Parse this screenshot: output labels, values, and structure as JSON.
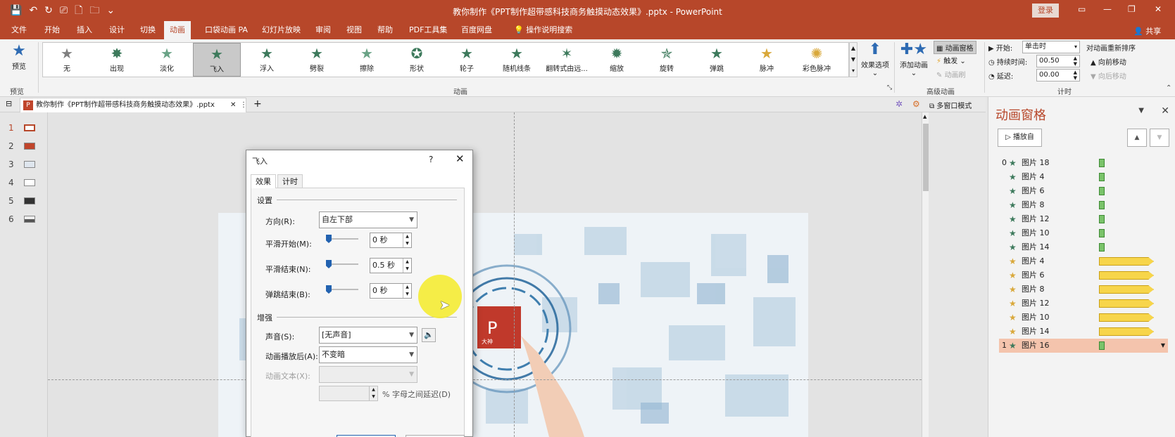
{
  "window": {
    "title": "教你制作《PPT制作超带感科技商务触摸动态效果》.pptx - PowerPoint",
    "login": "登录",
    "share": "共享"
  },
  "ribbon_tabs": [
    {
      "label": "文件"
    },
    {
      "label": "开始"
    },
    {
      "label": "插入"
    },
    {
      "label": "设计"
    },
    {
      "label": "切换"
    },
    {
      "label": "动画"
    },
    {
      "label": "口袋动画 PA"
    },
    {
      "label": "幻灯片放映"
    },
    {
      "label": "审阅"
    },
    {
      "label": "视图"
    },
    {
      "label": "帮助"
    },
    {
      "label": "PDF工具集"
    },
    {
      "label": "百度网盘"
    },
    {
      "label": "操作说明搜索"
    }
  ],
  "ribbon": {
    "preview_label": "预览",
    "preview_group": "预览",
    "animation_group": "动画",
    "advanced_group": "高级动画",
    "timing_group": "计时",
    "effects": [
      {
        "label": "无",
        "color": "#7f7f7f"
      },
      {
        "label": "出现",
        "color": "#3d7a5c"
      },
      {
        "label": "淡化",
        "color": "#6aa386"
      },
      {
        "label": "飞入",
        "color": "#3d7a5c"
      },
      {
        "label": "浮入",
        "color": "#3d7a5c"
      },
      {
        "label": "劈裂",
        "color": "#3d7a5c"
      },
      {
        "label": "擦除",
        "color": "#6aa386"
      },
      {
        "label": "形状",
        "color": "#3d7a5c"
      },
      {
        "label": "轮子",
        "color": "#3d7a5c"
      },
      {
        "label": "随机线条",
        "color": "#3d7a5c"
      },
      {
        "label": "翻转式由远...",
        "color": "#3d7a5c"
      },
      {
        "label": "缩放",
        "color": "#3d7a5c"
      },
      {
        "label": "旋转",
        "color": "#3d7a5c"
      },
      {
        "label": "弹跳",
        "color": "#3d7a5c"
      },
      {
        "label": "脉冲",
        "color": "#d9a83a"
      },
      {
        "label": "彩色脉冲",
        "color": "#d9a83a"
      }
    ],
    "effect_options": "效果选项",
    "add_animation": "添加动画",
    "animation_pane": "动画窗格",
    "trigger": "触发",
    "animation_painter": "动画刷",
    "start_label": "开始:",
    "start_value": "单击时",
    "duration_label": "持续时间:",
    "duration_value": "00.50",
    "delay_label": "延迟:",
    "delay_value": "00.00",
    "reorder_title": "对动画重新排序",
    "move_earlier": "向前移动",
    "move_later": "向后移动"
  },
  "doc_tab": {
    "icon": "P",
    "title": "教你制作《PPT制作超带感科技商务触摸动态效果》.pptx",
    "multi_window": "多窗口模式"
  },
  "slides": [
    {
      "num": "1"
    },
    {
      "num": "2"
    },
    {
      "num": "3"
    },
    {
      "num": "4"
    },
    {
      "num": "5"
    },
    {
      "num": "6"
    }
  ],
  "pane": {
    "title": "动画窗格",
    "play_from": "播放自",
    "items": [
      {
        "idx": "0",
        "name": "图片 18",
        "kind": "green",
        "star": "#3d7a5c"
      },
      {
        "idx": "",
        "name": "图片 4",
        "kind": "green",
        "star": "#3d7a5c"
      },
      {
        "idx": "",
        "name": "图片 6",
        "kind": "green",
        "star": "#3d7a5c"
      },
      {
        "idx": "",
        "name": "图片 8",
        "kind": "green",
        "star": "#3d7a5c"
      },
      {
        "idx": "",
        "name": "图片 12",
        "kind": "green",
        "star": "#3d7a5c"
      },
      {
        "idx": "",
        "name": "图片 10",
        "kind": "green",
        "star": "#3d7a5c"
      },
      {
        "idx": "",
        "name": "图片 14",
        "kind": "green",
        "star": "#3d7a5c"
      },
      {
        "idx": "",
        "name": "图片 4",
        "kind": "yellow",
        "star": "#d9a83a"
      },
      {
        "idx": "",
        "name": "图片 6",
        "kind": "yellow",
        "star": "#d9a83a"
      },
      {
        "idx": "",
        "name": "图片 8",
        "kind": "yellow",
        "star": "#d9a83a"
      },
      {
        "idx": "",
        "name": "图片 12",
        "kind": "yellow",
        "star": "#d9a83a"
      },
      {
        "idx": "",
        "name": "图片 10",
        "kind": "yellow",
        "star": "#d9a83a"
      },
      {
        "idx": "",
        "name": "图片 14",
        "kind": "yellow",
        "star": "#d9a83a"
      },
      {
        "idx": "1",
        "name": "图片 16",
        "kind": "green",
        "star": "#3d7a5c",
        "selected": true
      }
    ]
  },
  "dialog": {
    "title": "飞入",
    "help": "?",
    "tab_effect": "效果",
    "tab_timing": "计时",
    "section_settings": "设置",
    "direction_label": "方向(R):",
    "direction_value": "自左下部",
    "smooth_start_label": "平滑开始(M):",
    "smooth_start_value": "0 秒",
    "smooth_end_label": "平滑结束(N):",
    "smooth_end_value": "0.5 秒",
    "bounce_end_label": "弹跳结束(B):",
    "bounce_end_value": "0 秒",
    "section_enhance": "增强",
    "sound_label": "声音(S):",
    "sound_value": "[无声音]",
    "after_label": "动画播放后(A):",
    "after_value": "不变暗",
    "text_label": "动画文本(X):",
    "text_value": "",
    "delay_value": "",
    "delay_suffix": "% 字母之间延迟(D)"
  },
  "slide_badges": {
    "a": "1",
    "b": "0"
  },
  "logo_text": "P",
  "logo_caption": "大神"
}
